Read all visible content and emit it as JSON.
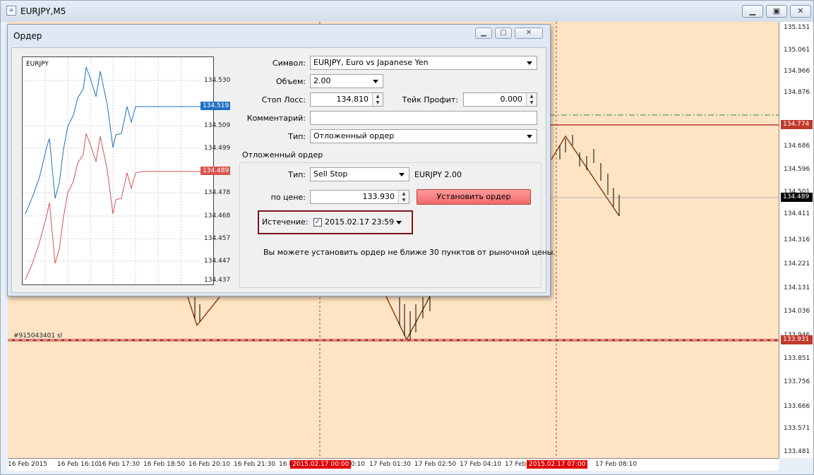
{
  "chart_window": {
    "title": "EURJPY,M5",
    "price_labels": [
      "135.151",
      "135.061",
      "134.966",
      "134.876",
      "134.686",
      "134.596",
      "134.501",
      "134.411",
      "134.316",
      "134.221",
      "134.131",
      "134.036",
      "133.946",
      "133.851",
      "133.756",
      "133.666",
      "133.571",
      "133.481"
    ],
    "price_tags": [
      {
        "text": "134.774",
        "color": "#c0392b"
      },
      {
        "text": "134.489",
        "color": "#000000"
      },
      {
        "text": "133.931",
        "color": "#c0392b"
      }
    ],
    "time_labels": [
      "16 Feb 2015",
      "16 Feb 16:10",
      "16 Feb 17:30",
      "16 Feb 18:50",
      "16 Feb 20:10",
      "16 Feb 21:30",
      "16 F",
      "00:10",
      "17 Feb 01:30",
      "17 Feb 02:50",
      "17 Feb 04:10",
      "17 Feb",
      "17 Feb 08:10"
    ],
    "time_tags": [
      "2015.02.17 00:00",
      "2015.02.17 07:00"
    ],
    "ticket_label": "#915043401 sl"
  },
  "order_dialog": {
    "title": "Ордер",
    "mini_chart": {
      "symbol": "EURJPY",
      "price_labels": [
        "134.530",
        "134.509",
        "134.499",
        "134.478",
        "134.468",
        "134.457",
        "134.447",
        "134.437"
      ],
      "ask_tag": "134.519",
      "bid_tag": "134.489"
    },
    "symbol": {
      "label": "Символ:",
      "value": "EURJPY, Euro vs Japanese Yen"
    },
    "volume": {
      "label": "Объем:",
      "value": "2.00"
    },
    "stop_loss": {
      "label": "Стоп Лосс:",
      "value": "134.810"
    },
    "take_profit": {
      "label": "Тейк Профит:",
      "value": "0.000"
    },
    "comment": {
      "label": "Комментарий:",
      "value": ""
    },
    "type": {
      "label": "Тип:",
      "value": "Отложенный ордер"
    },
    "pending": {
      "group_label": "Отложенный ордер",
      "type_label": "Тип:",
      "type_value": "Sell Stop",
      "summary": "EURJPY 2.00",
      "price_label": "по цене:",
      "price_value": "133.930",
      "set_button": "Установить ордер",
      "expiration_label": "Истечение:",
      "expiration_checked": "✓",
      "expiration_value": "2015.02.17 23:59",
      "hint": "Вы можете установить ордер не ближе 30 пунктов от рыночной цены."
    }
  },
  "colors": {
    "ask": "#1f6fc5",
    "bid": "#d9534f",
    "chart_bg": "#ffe4c4",
    "button": "#f07070"
  }
}
